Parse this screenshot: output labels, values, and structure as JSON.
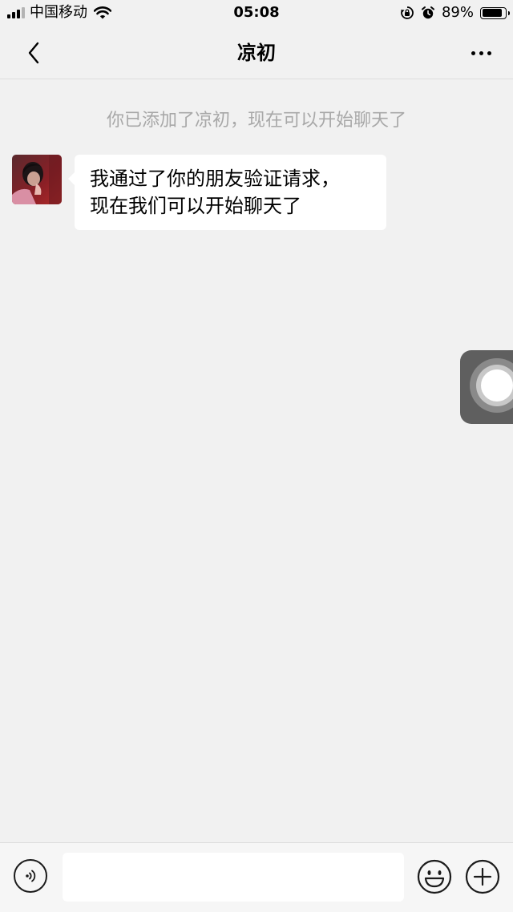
{
  "status_bar": {
    "carrier": "中国移动",
    "time": "05:08",
    "battery_percent": "89%",
    "battery_level": 0.89,
    "icons": [
      "signal-icon",
      "wifi-icon",
      "rotation-lock-icon",
      "alarm-icon",
      "battery-icon"
    ]
  },
  "nav": {
    "title": "凉初",
    "back_icon": "chevron-left-icon",
    "more_icon": "more-dots-icon"
  },
  "chat": {
    "system_message": "你已添加了凉初，现在可以开始聊天了",
    "messages": [
      {
        "sender": "凉初",
        "avatar": "avatar",
        "text": "我通过了你的朋友验证请求，\n现在我们可以开始聊天了"
      }
    ]
  },
  "input_bar": {
    "voice_icon": "voice-icon",
    "placeholder": "",
    "emoji_icon": "emoji-icon",
    "plus_icon": "plus-icon"
  },
  "colors": {
    "background": "#f1f1f1",
    "bubble": "#ffffff",
    "system_text": "#a8a8a8"
  }
}
